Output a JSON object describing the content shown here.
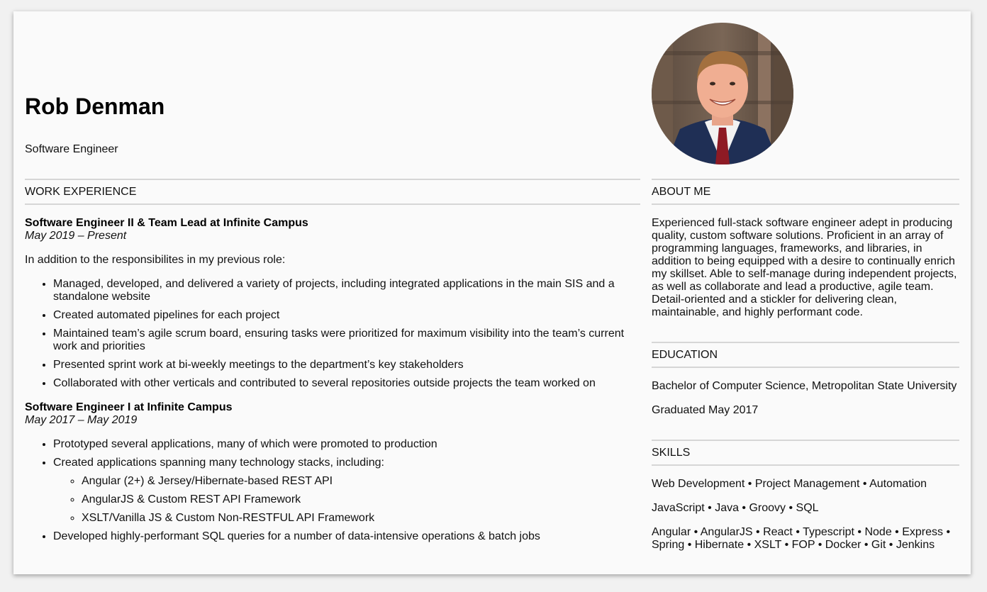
{
  "header": {
    "name": "Rob Denman",
    "title": "Software Engineer"
  },
  "work": {
    "heading": "WORK EXPERIENCE",
    "jobs": [
      {
        "title": "Software Engineer II & Team Lead at Infinite Campus",
        "dates": "May 2019 – Present",
        "intro": "In addition to the responsibilites in my previous role:",
        "bullets": [
          "Managed, developed, and delivered a variety of projects, including integrated applications in the main SIS and a standalone website",
          "Created automated pipelines for each project",
          "Maintained team’s agile scrum board, ensuring tasks were prioritized for maximum visibility into the team’s current work and priorities",
          "Presented sprint work at bi-weekly meetings to the department’s key stakeholders",
          "Collaborated with other verticals and contributed to several repositories outside projects the team worked on"
        ]
      },
      {
        "title": "Software Engineer I at Infinite Campus",
        "dates": "May 2017 – May 2019",
        "bullets": [
          "Prototyped several applications, many of which were promoted to production",
          "Created applications spanning many technology stacks, including:",
          "Developed highly-performant SQL queries for a number of data-intensive operations & batch jobs"
        ],
        "sub_bullets": [
          "Angular (2+) & Jersey/Hibernate-based REST API",
          "AngularJS & Custom REST API Framework",
          "XSLT/Vanilla JS & Custom Non-RESTFUL API Framework"
        ]
      }
    ]
  },
  "about": {
    "heading": "ABOUT ME",
    "text": "Experienced full-stack software engineer adept in producing quality, custom software solutions. Proficient in an array of programming languages, frameworks, and libraries, in addition to being equipped with a desire to continually enrich my skillset. Able to self-manage during independent projects, as well as collaborate and lead a productive, agile team. Detail-oriented and a stickler for delivering clean, maintainable, and highly performant code."
  },
  "education": {
    "heading": "EDUCATION",
    "degree": "Bachelor of Computer Science, Metropolitan State University",
    "graduated": "Graduated May 2017"
  },
  "skills": {
    "heading": "SKILLS",
    "lines": [
      "Web Development • Project Management • Automation",
      "JavaScript • Java • Groovy • SQL",
      "Angular • AngularJS • React • Typescript • Node • Express • Spring • Hibernate • XSLT • FOP • Docker • Git • Jenkins"
    ]
  },
  "colors": {
    "page_background": "#f1f1f1",
    "paper": "#fafafa",
    "rule": "#d6d6d6",
    "text": "#111111"
  }
}
